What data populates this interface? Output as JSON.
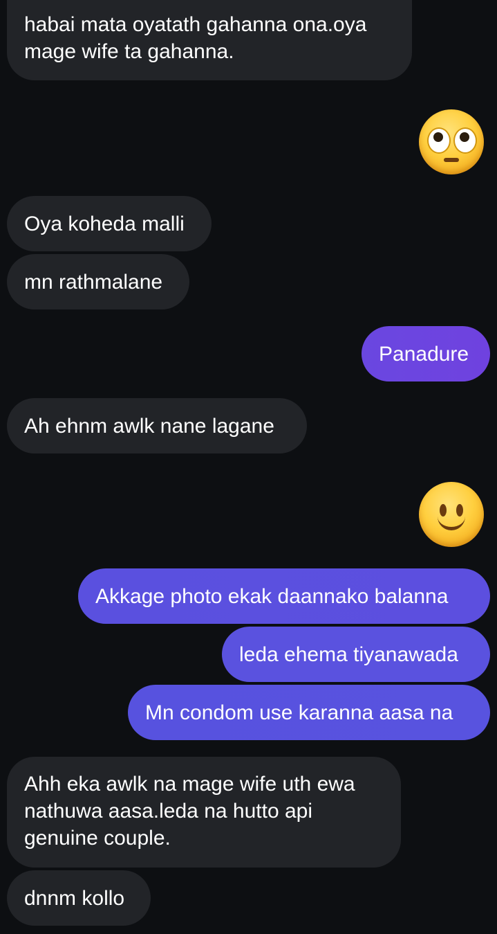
{
  "colors": {
    "background": "#0d0f12",
    "incoming_bubble": "#222428",
    "outgoing_bubble_gradient": [
      "#6f45df",
      "#5a51df"
    ],
    "text": "#ffffff"
  },
  "messages": [
    {
      "side": "incoming",
      "text": "habai mata oyatath gahanna ona.oya mage wife ta gahanna."
    },
    {
      "side": "outgoing",
      "type": "emoji",
      "emoji": "face-with-rolling-eyes"
    },
    {
      "side": "incoming",
      "text": "Oya koheda malli"
    },
    {
      "side": "incoming",
      "text": "mn rathmalane"
    },
    {
      "side": "outgoing",
      "text": "Panadure"
    },
    {
      "side": "incoming",
      "text": "Ah ehnm awlk nane lagane"
    },
    {
      "side": "outgoing",
      "type": "emoji",
      "emoji": "slightly-smiling-face"
    },
    {
      "side": "outgoing",
      "text": "Akkage photo ekak daannako balanna"
    },
    {
      "side": "outgoing",
      "text": "leda ehema tiyanawada"
    },
    {
      "side": "outgoing",
      "text": "Mn condom use karanna aasa na"
    },
    {
      "side": "incoming",
      "text": "Ahh eka awlk na mage wife uth ewa nathuwa aasa.leda na hutto api genuine couple."
    },
    {
      "side": "incoming",
      "text": "dnnm kollo"
    }
  ]
}
